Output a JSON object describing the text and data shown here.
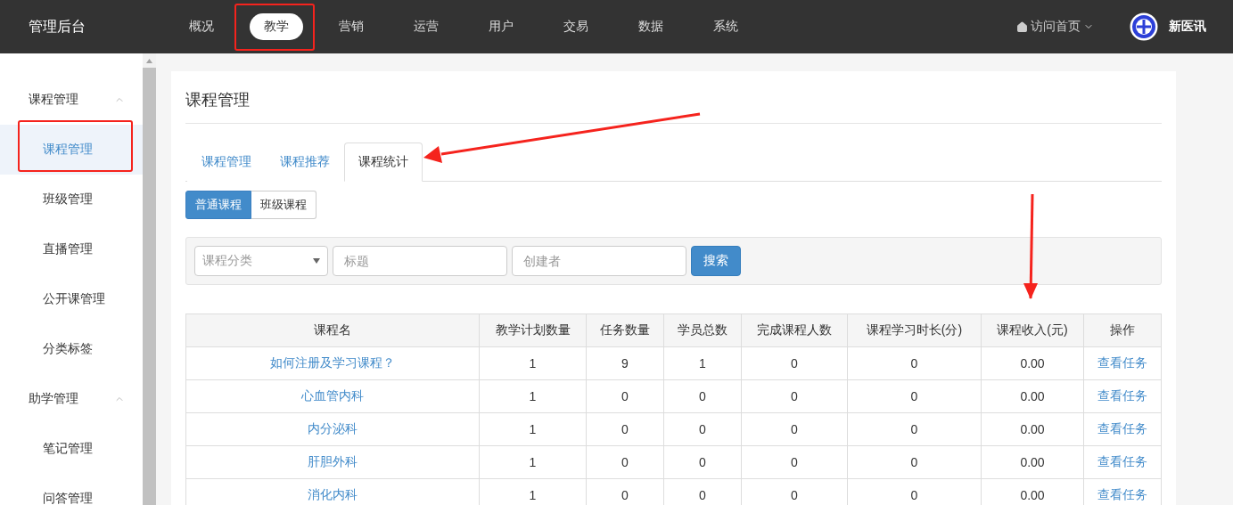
{
  "brand": "管理后台",
  "nav": [
    {
      "label": "概况",
      "selected": false
    },
    {
      "label": "教学",
      "selected": true
    },
    {
      "label": "营销",
      "selected": false
    },
    {
      "label": "运营",
      "selected": false
    },
    {
      "label": "用户",
      "selected": false
    },
    {
      "label": "交易",
      "selected": false
    },
    {
      "label": "数据",
      "selected": false
    },
    {
      "label": "系统",
      "selected": false
    }
  ],
  "home_link": "访问首页",
  "user_name": "新医讯",
  "sidebar": [
    {
      "label": "课程管理",
      "expanded": true,
      "children": [
        {
          "label": "课程管理",
          "selected": true
        },
        {
          "label": "班级管理",
          "selected": false
        },
        {
          "label": "直播管理",
          "selected": false
        },
        {
          "label": "公开课管理",
          "selected": false
        },
        {
          "label": "分类标签",
          "selected": false
        }
      ]
    },
    {
      "label": "助学管理",
      "expanded": true,
      "children": [
        {
          "label": "笔记管理",
          "selected": false
        },
        {
          "label": "问答管理",
          "selected": false
        }
      ]
    }
  ],
  "page_title": "课程管理",
  "tabs": [
    {
      "label": "课程管理",
      "selected": false
    },
    {
      "label": "课程推荐",
      "selected": false
    },
    {
      "label": "课程统计",
      "selected": true
    }
  ],
  "course_types": [
    {
      "label": "普通课程",
      "selected": true
    },
    {
      "label": "班级课程",
      "selected": false
    }
  ],
  "filters": {
    "category": {
      "placeholder": "课程分类"
    },
    "title": {
      "placeholder": "标题"
    },
    "creator": {
      "placeholder": "创建者"
    },
    "search_button": "搜索"
  },
  "table": {
    "columns": [
      "课程名",
      "教学计划数量",
      "任务数量",
      "学员总数",
      "完成课程人数",
      "课程学习时长(分)",
      "课程收入(元)",
      "操作"
    ],
    "rows": [
      [
        "如何注册及学习课程？",
        "1",
        "9",
        "1",
        "0",
        "0",
        "0.00",
        "查看任务"
      ],
      [
        "心血管内科",
        "1",
        "0",
        "0",
        "0",
        "0",
        "0.00",
        "查看任务"
      ],
      [
        "内分泌科",
        "1",
        "0",
        "0",
        "0",
        "0",
        "0.00",
        "查看任务"
      ],
      [
        "肝胆外科",
        "1",
        "0",
        "0",
        "0",
        "0",
        "0.00",
        "查看任务"
      ],
      [
        "消化内科",
        "1",
        "0",
        "0",
        "0",
        "0",
        "0.00",
        "查看任务"
      ]
    ]
  }
}
